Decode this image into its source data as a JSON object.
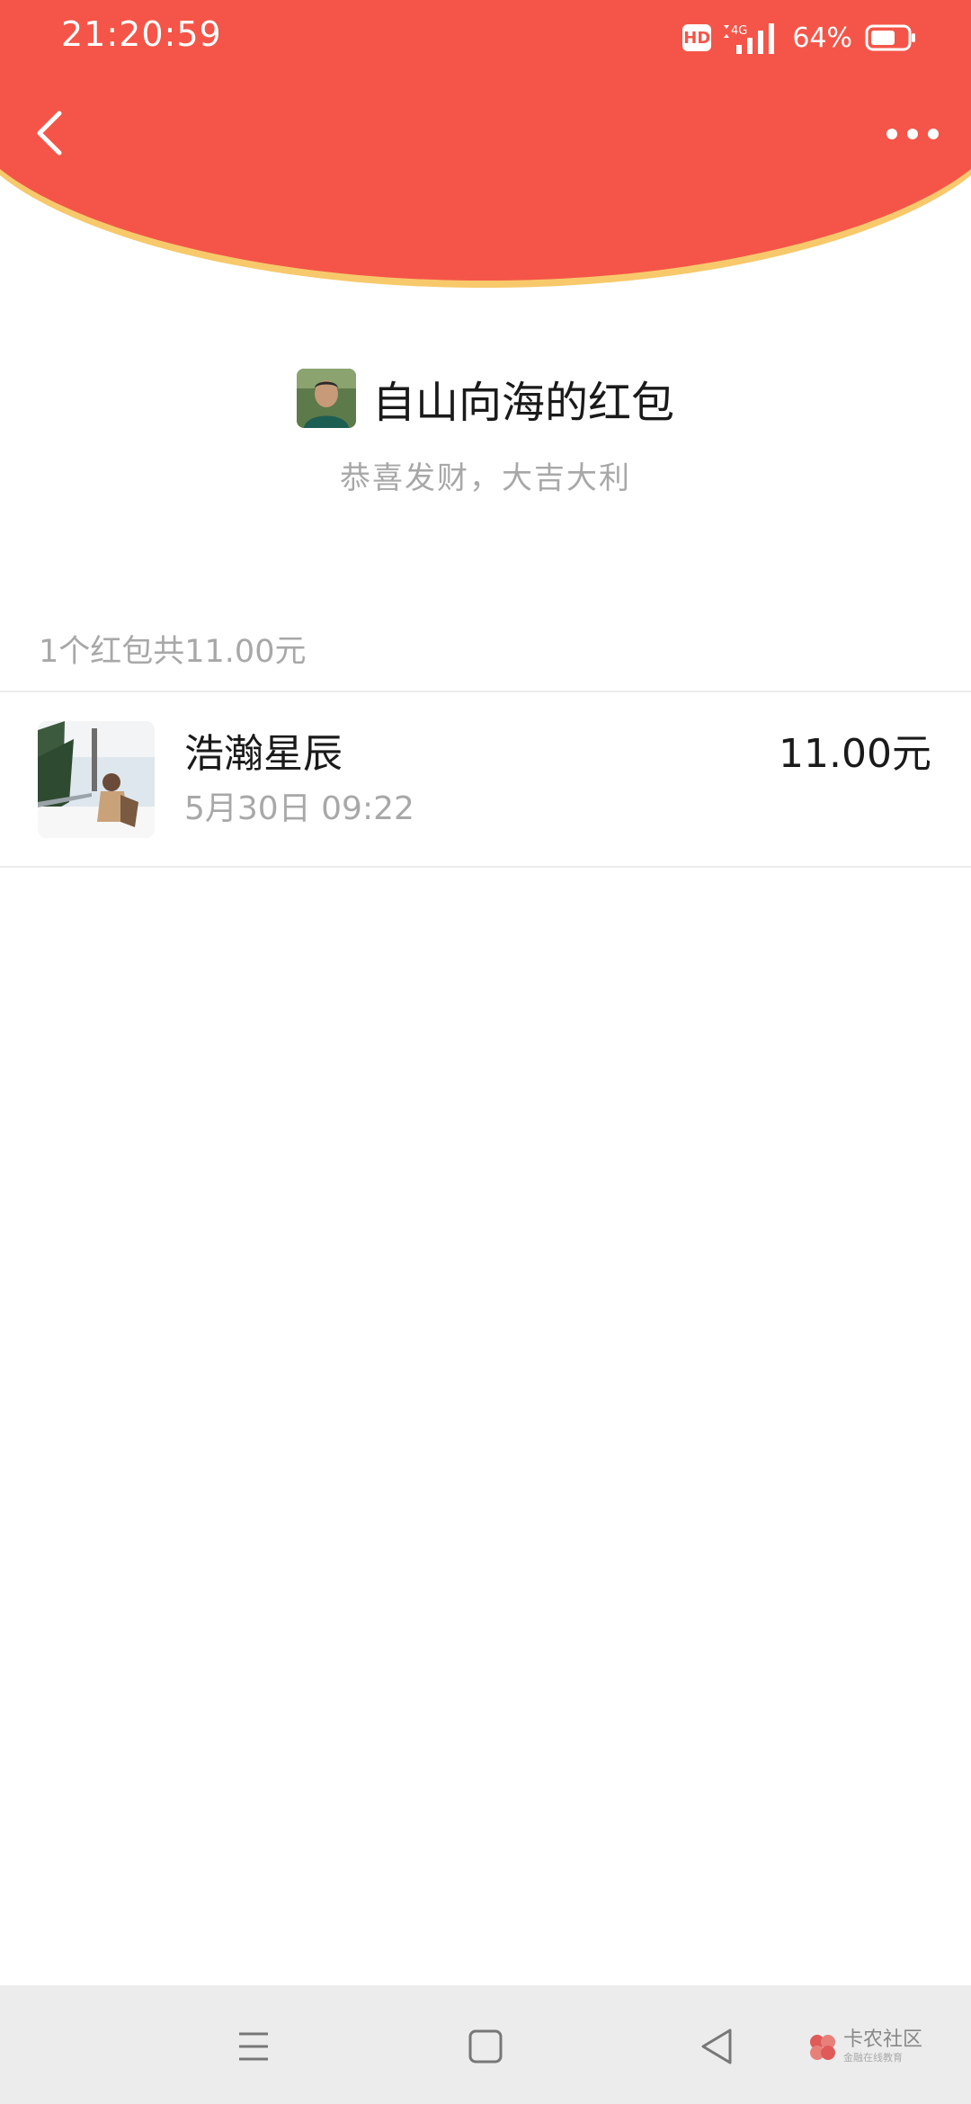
{
  "status_bar": {
    "time": "21:20:59",
    "hd": "HD",
    "network": "4G",
    "battery": "64%"
  },
  "nav": {
    "back_icon": "chevron-left-icon",
    "more_icon": "more-dots-icon"
  },
  "colors": {
    "header_red": "#f55548",
    "header_border": "#f7c96b",
    "muted_text": "#a8a8a8"
  },
  "envelope": {
    "title": "自山向海的红包",
    "greeting": "恭喜发财，大吉大利"
  },
  "summary": "1个红包共11.00元",
  "records": [
    {
      "name": "浩瀚星辰",
      "time": "5月30日  09:22",
      "amount": "11.00元"
    }
  ],
  "system_nav": {
    "menu_icon": "menu-icon",
    "home_icon": "home-square-icon",
    "back_icon": "back-triangle-icon"
  },
  "watermark": {
    "name": "卡农社区",
    "sub": "金融在线教育"
  }
}
